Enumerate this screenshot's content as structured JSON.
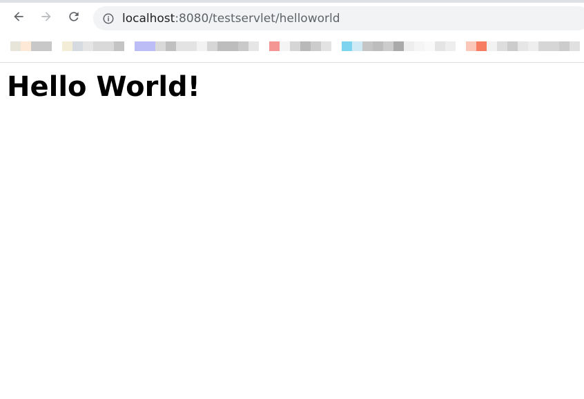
{
  "browser": {
    "address_bar": {
      "host": "localhost",
      "rest": ":8080/testservlet/helloworld"
    },
    "icons": {
      "back": "arrow-left-icon",
      "forward": "arrow-right-icon",
      "reload": "reload-icon",
      "site_info": "info-icon"
    },
    "bookmarks_bar": {
      "note": "",
      "groups": [
        [
          "#e7e5d9",
          "#fde9d6",
          "#c8c8c8",
          "#c8c8c8",
          "#ffffff",
          "#f3ecd6",
          "#d6dbe2",
          "#e5e5e5",
          "#d9d9d9",
          "#d9d9d9",
          "#c4c4c4"
        ],
        [
          "#bcbcf6",
          "#bcbcf6",
          "#d9d9d9",
          "#c0c0c0",
          "#e3e3e3",
          "#e3e3e3",
          "#f2f2f2",
          "#d6d6d6",
          "#bdbdbd",
          "#bdbdbd",
          "#c9c9c9",
          "#e6e6e6"
        ],
        [
          "#f39694",
          "#f4f4f4",
          "#d5d5d5",
          "#b9b9b9",
          "#cccccc",
          "#e3e3e3"
        ],
        [
          "#7dd4ef",
          "#cfeaf4",
          "#c5c5c5",
          "#bdbdbd",
          "#cccccc",
          "#aaaaaa",
          "#eeeeee",
          "#f5f5f5",
          "#f9f9f9",
          "#e4e4e4",
          "#eeeeee"
        ],
        [
          "#fbc7b8",
          "#f77d62",
          "#f2f2f2",
          "#dddddd",
          "#cccccc",
          "#e6e6e6",
          "#eeeeee",
          "#d6d6d6",
          "#d6d6d6",
          "#cccccc",
          "#e0e0e0"
        ]
      ]
    }
  },
  "page": {
    "heading": "Hello World!"
  }
}
